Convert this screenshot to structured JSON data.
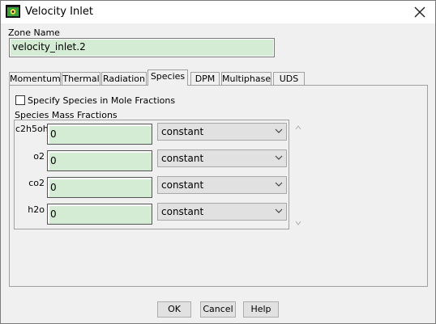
{
  "window": {
    "title": "Velocity Inlet",
    "close_symbol": "✕"
  },
  "zone": {
    "label": "Zone Name",
    "value": "velocity_inlet.2"
  },
  "tabs": [
    {
      "label": "Momentum",
      "active": false
    },
    {
      "label": "Thermal",
      "active": false
    },
    {
      "label": "Radiation",
      "active": false
    },
    {
      "label": "Species",
      "active": true
    },
    {
      "label": "DPM",
      "active": false
    },
    {
      "label": "Multiphase",
      "active": false
    },
    {
      "label": "UDS",
      "active": false
    }
  ],
  "species": {
    "mole_fraction_checkbox_label": "Specify Species in Mole Fractions",
    "mole_fraction_checked": false,
    "section_label": "Species Mass Fractions",
    "rows": [
      {
        "name": "c2h5oh",
        "value": "0",
        "method": "constant"
      },
      {
        "name": "o2",
        "value": "0",
        "method": "constant"
      },
      {
        "name": "co2",
        "value": "0",
        "method": "constant"
      },
      {
        "name": "h2o",
        "value": "0",
        "method": "constant"
      }
    ]
  },
  "buttons": {
    "ok": "OK",
    "cancel": "Cancel",
    "help": "Help"
  },
  "colors": {
    "field_bg": "#d4ecd4",
    "window_bg": "#f0f0f0",
    "button_bg": "#e1e1e1"
  }
}
